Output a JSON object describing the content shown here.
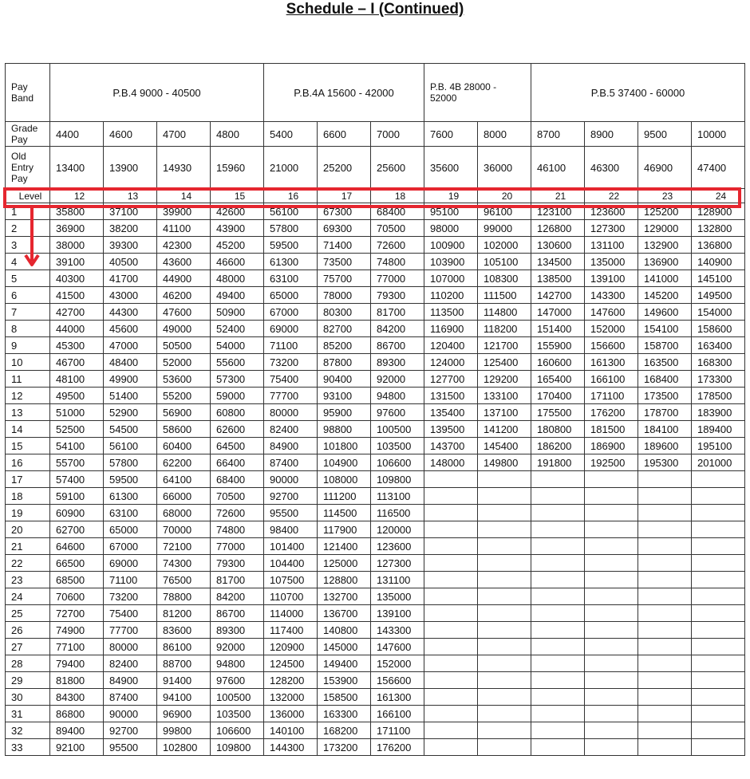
{
  "title": "Schedule – I (Continued)",
  "labels": {
    "pay_band": "Pay\nBand",
    "grade_pay": "Grade\nPay",
    "old_entry": "Old\nEntry\nPay",
    "level": "Level"
  },
  "bands": [
    {
      "name": "P.B.4    9000 - 40500",
      "span": 4
    },
    {
      "name": "P.B.4A    15600 - 42000",
      "span": 3
    },
    {
      "name": "P.B. 4B    28000 -\n52000",
      "span": 2
    },
    {
      "name": "P.B.5    37400 - 60000",
      "span": 4
    }
  ],
  "grade_pay": [
    "4400",
    "4600",
    "4700",
    "4800",
    "5400",
    "6600",
    "7000",
    "7600",
    "8000",
    "8700",
    "8900",
    "9500",
    "10000"
  ],
  "old_entry_pay": [
    "13400",
    "13900",
    "14930",
    "15960",
    "21000",
    "25200",
    "25600",
    "35600",
    "36000",
    "46100",
    "46300",
    "46900",
    "47400"
  ],
  "levels": [
    "12",
    "13",
    "14",
    "15",
    "16",
    "17",
    "18",
    "19",
    "20",
    "21",
    "22",
    "23",
    "24"
  ],
  "rows": [
    [
      "1",
      "35800",
      "37100",
      "39900",
      "42600",
      "56100",
      "67300",
      "68400",
      "95100",
      "96100",
      "123100",
      "123600",
      "125200",
      "128900"
    ],
    [
      "2",
      "36900",
      "38200",
      "41100",
      "43900",
      "57800",
      "69300",
      "70500",
      "98000",
      "99000",
      "126800",
      "127300",
      "129000",
      "132800"
    ],
    [
      "3",
      "38000",
      "39300",
      "42300",
      "45200",
      "59500",
      "71400",
      "72600",
      "100900",
      "102000",
      "130600",
      "131100",
      "132900",
      "136800"
    ],
    [
      "4",
      "39100",
      "40500",
      "43600",
      "46600",
      "61300",
      "73500",
      "74800",
      "103900",
      "105100",
      "134500",
      "135000",
      "136900",
      "140900"
    ],
    [
      "5",
      "40300",
      "41700",
      "44900",
      "48000",
      "63100",
      "75700",
      "77000",
      "107000",
      "108300",
      "138500",
      "139100",
      "141000",
      "145100"
    ],
    [
      "6",
      "41500",
      "43000",
      "46200",
      "49400",
      "65000",
      "78000",
      "79300",
      "110200",
      "111500",
      "142700",
      "143300",
      "145200",
      "149500"
    ],
    [
      "7",
      "42700",
      "44300",
      "47600",
      "50900",
      "67000",
      "80300",
      "81700",
      "113500",
      "114800",
      "147000",
      "147600",
      "149600",
      "154000"
    ],
    [
      "8",
      "44000",
      "45600",
      "49000",
      "52400",
      "69000",
      "82700",
      "84200",
      "116900",
      "118200",
      "151400",
      "152000",
      "154100",
      "158600"
    ],
    [
      "9",
      "45300",
      "47000",
      "50500",
      "54000",
      "71100",
      "85200",
      "86700",
      "120400",
      "121700",
      "155900",
      "156600",
      "158700",
      "163400"
    ],
    [
      "10",
      "46700",
      "48400",
      "52000",
      "55600",
      "73200",
      "87800",
      "89300",
      "124000",
      "125400",
      "160600",
      "161300",
      "163500",
      "168300"
    ],
    [
      "11",
      "48100",
      "49900",
      "53600",
      "57300",
      "75400",
      "90400",
      "92000",
      "127700",
      "129200",
      "165400",
      "166100",
      "168400",
      "173300"
    ],
    [
      "12",
      "49500",
      "51400",
      "55200",
      "59000",
      "77700",
      "93100",
      "94800",
      "131500",
      "133100",
      "170400",
      "171100",
      "173500",
      "178500"
    ],
    [
      "13",
      "51000",
      "52900",
      "56900",
      "60800",
      "80000",
      "95900",
      "97600",
      "135400",
      "137100",
      "175500",
      "176200",
      "178700",
      "183900"
    ],
    [
      "14",
      "52500",
      "54500",
      "58600",
      "62600",
      "82400",
      "98800",
      "100500",
      "139500",
      "141200",
      "180800",
      "181500",
      "184100",
      "189400"
    ],
    [
      "15",
      "54100",
      "56100",
      "60400",
      "64500",
      "84900",
      "101800",
      "103500",
      "143700",
      "145400",
      "186200",
      "186900",
      "189600",
      "195100"
    ],
    [
      "16",
      "55700",
      "57800",
      "62200",
      "66400",
      "87400",
      "104900",
      "106600",
      "148000",
      "149800",
      "191800",
      "192500",
      "195300",
      "201000"
    ],
    [
      "17",
      "57400",
      "59500",
      "64100",
      "68400",
      "90000",
      "108000",
      "109800",
      "",
      "",
      "",
      "",
      "",
      ""
    ],
    [
      "18",
      "59100",
      "61300",
      "66000",
      "70500",
      "92700",
      "111200",
      "113100",
      "",
      "",
      "",
      "",
      "",
      ""
    ],
    [
      "19",
      "60900",
      "63100",
      "68000",
      "72600",
      "95500",
      "114500",
      "116500",
      "",
      "",
      "",
      "",
      "",
      ""
    ],
    [
      "20",
      "62700",
      "65000",
      "70000",
      "74800",
      "98400",
      "117900",
      "120000",
      "",
      "",
      "",
      "",
      "",
      ""
    ],
    [
      "21",
      "64600",
      "67000",
      "72100",
      "77000",
      "101400",
      "121400",
      "123600",
      "",
      "",
      "",
      "",
      "",
      ""
    ],
    [
      "22",
      "66500",
      "69000",
      "74300",
      "79300",
      "104400",
      "125000",
      "127300",
      "",
      "",
      "",
      "",
      "",
      ""
    ],
    [
      "23",
      "68500",
      "71100",
      "76500",
      "81700",
      "107500",
      "128800",
      "131100",
      "",
      "",
      "",
      "",
      "",
      ""
    ],
    [
      "24",
      "70600",
      "73200",
      "78800",
      "84200",
      "110700",
      "132700",
      "135000",
      "",
      "",
      "",
      "",
      "",
      ""
    ],
    [
      "25",
      "72700",
      "75400",
      "81200",
      "86700",
      "114000",
      "136700",
      "139100",
      "",
      "",
      "",
      "",
      "",
      ""
    ],
    [
      "26",
      "74900",
      "77700",
      "83600",
      "89300",
      "117400",
      "140800",
      "143300",
      "",
      "",
      "",
      "",
      "",
      ""
    ],
    [
      "27",
      "77100",
      "80000",
      "86100",
      "92000",
      "120900",
      "145000",
      "147600",
      "",
      "",
      "",
      "",
      "",
      ""
    ],
    [
      "28",
      "79400",
      "82400",
      "88700",
      "94800",
      "124500",
      "149400",
      "152000",
      "",
      "",
      "",
      "",
      "",
      ""
    ],
    [
      "29",
      "81800",
      "84900",
      "91400",
      "97600",
      "128200",
      "153900",
      "156600",
      "",
      "",
      "",
      "",
      "",
      ""
    ],
    [
      "30",
      "84300",
      "87400",
      "94100",
      "100500",
      "132000",
      "158500",
      "161300",
      "",
      "",
      "",
      "",
      "",
      ""
    ],
    [
      "31",
      "86800",
      "90000",
      "96900",
      "103500",
      "136000",
      "163300",
      "166100",
      "",
      "",
      "",
      "",
      "",
      ""
    ],
    [
      "32",
      "89400",
      "92700",
      "99800",
      "106600",
      "140100",
      "168200",
      "171100",
      "",
      "",
      "",
      "",
      "",
      ""
    ],
    [
      "33",
      "92100",
      "95500",
      "102800",
      "109800",
      "144300",
      "173200",
      "176200",
      "",
      "",
      "",
      "",
      "",
      ""
    ]
  ],
  "annotation_color": "#e5262f"
}
